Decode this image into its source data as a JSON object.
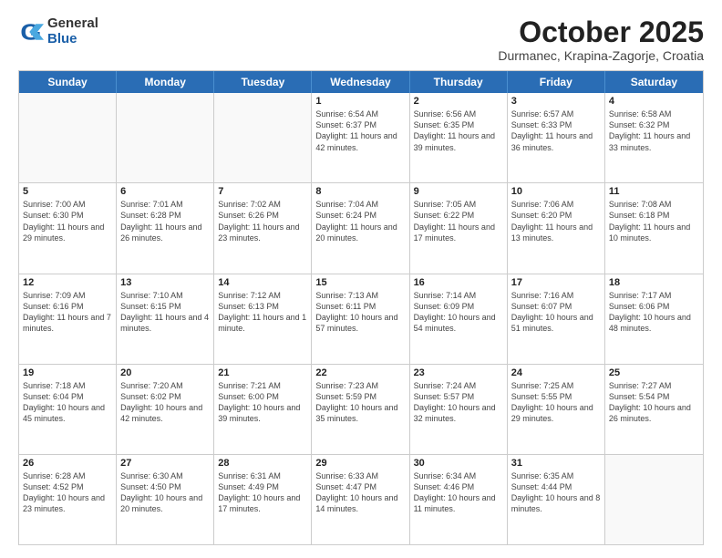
{
  "logo": {
    "general": "General",
    "blue": "Blue"
  },
  "title": "October 2025",
  "subtitle": "Durmanec, Krapina-Zagorje, Croatia",
  "headers": [
    "Sunday",
    "Monday",
    "Tuesday",
    "Wednesday",
    "Thursday",
    "Friday",
    "Saturday"
  ],
  "weeks": [
    [
      {
        "day": "",
        "info": ""
      },
      {
        "day": "",
        "info": ""
      },
      {
        "day": "",
        "info": ""
      },
      {
        "day": "1",
        "info": "Sunrise: 6:54 AM\nSunset: 6:37 PM\nDaylight: 11 hours and 42 minutes."
      },
      {
        "day": "2",
        "info": "Sunrise: 6:56 AM\nSunset: 6:35 PM\nDaylight: 11 hours and 39 minutes."
      },
      {
        "day": "3",
        "info": "Sunrise: 6:57 AM\nSunset: 6:33 PM\nDaylight: 11 hours and 36 minutes."
      },
      {
        "day": "4",
        "info": "Sunrise: 6:58 AM\nSunset: 6:32 PM\nDaylight: 11 hours and 33 minutes."
      }
    ],
    [
      {
        "day": "5",
        "info": "Sunrise: 7:00 AM\nSunset: 6:30 PM\nDaylight: 11 hours and 29 minutes."
      },
      {
        "day": "6",
        "info": "Sunrise: 7:01 AM\nSunset: 6:28 PM\nDaylight: 11 hours and 26 minutes."
      },
      {
        "day": "7",
        "info": "Sunrise: 7:02 AM\nSunset: 6:26 PM\nDaylight: 11 hours and 23 minutes."
      },
      {
        "day": "8",
        "info": "Sunrise: 7:04 AM\nSunset: 6:24 PM\nDaylight: 11 hours and 20 minutes."
      },
      {
        "day": "9",
        "info": "Sunrise: 7:05 AM\nSunset: 6:22 PM\nDaylight: 11 hours and 17 minutes."
      },
      {
        "day": "10",
        "info": "Sunrise: 7:06 AM\nSunset: 6:20 PM\nDaylight: 11 hours and 13 minutes."
      },
      {
        "day": "11",
        "info": "Sunrise: 7:08 AM\nSunset: 6:18 PM\nDaylight: 11 hours and 10 minutes."
      }
    ],
    [
      {
        "day": "12",
        "info": "Sunrise: 7:09 AM\nSunset: 6:16 PM\nDaylight: 11 hours and 7 minutes."
      },
      {
        "day": "13",
        "info": "Sunrise: 7:10 AM\nSunset: 6:15 PM\nDaylight: 11 hours and 4 minutes."
      },
      {
        "day": "14",
        "info": "Sunrise: 7:12 AM\nSunset: 6:13 PM\nDaylight: 11 hours and 1 minute."
      },
      {
        "day": "15",
        "info": "Sunrise: 7:13 AM\nSunset: 6:11 PM\nDaylight: 10 hours and 57 minutes."
      },
      {
        "day": "16",
        "info": "Sunrise: 7:14 AM\nSunset: 6:09 PM\nDaylight: 10 hours and 54 minutes."
      },
      {
        "day": "17",
        "info": "Sunrise: 7:16 AM\nSunset: 6:07 PM\nDaylight: 10 hours and 51 minutes."
      },
      {
        "day": "18",
        "info": "Sunrise: 7:17 AM\nSunset: 6:06 PM\nDaylight: 10 hours and 48 minutes."
      }
    ],
    [
      {
        "day": "19",
        "info": "Sunrise: 7:18 AM\nSunset: 6:04 PM\nDaylight: 10 hours and 45 minutes."
      },
      {
        "day": "20",
        "info": "Sunrise: 7:20 AM\nSunset: 6:02 PM\nDaylight: 10 hours and 42 minutes."
      },
      {
        "day": "21",
        "info": "Sunrise: 7:21 AM\nSunset: 6:00 PM\nDaylight: 10 hours and 39 minutes."
      },
      {
        "day": "22",
        "info": "Sunrise: 7:23 AM\nSunset: 5:59 PM\nDaylight: 10 hours and 35 minutes."
      },
      {
        "day": "23",
        "info": "Sunrise: 7:24 AM\nSunset: 5:57 PM\nDaylight: 10 hours and 32 minutes."
      },
      {
        "day": "24",
        "info": "Sunrise: 7:25 AM\nSunset: 5:55 PM\nDaylight: 10 hours and 29 minutes."
      },
      {
        "day": "25",
        "info": "Sunrise: 7:27 AM\nSunset: 5:54 PM\nDaylight: 10 hours and 26 minutes."
      }
    ],
    [
      {
        "day": "26",
        "info": "Sunrise: 6:28 AM\nSunset: 4:52 PM\nDaylight: 10 hours and 23 minutes."
      },
      {
        "day": "27",
        "info": "Sunrise: 6:30 AM\nSunset: 4:50 PM\nDaylight: 10 hours and 20 minutes."
      },
      {
        "day": "28",
        "info": "Sunrise: 6:31 AM\nSunset: 4:49 PM\nDaylight: 10 hours and 17 minutes."
      },
      {
        "day": "29",
        "info": "Sunrise: 6:33 AM\nSunset: 4:47 PM\nDaylight: 10 hours and 14 minutes."
      },
      {
        "day": "30",
        "info": "Sunrise: 6:34 AM\nSunset: 4:46 PM\nDaylight: 10 hours and 11 minutes."
      },
      {
        "day": "31",
        "info": "Sunrise: 6:35 AM\nSunset: 4:44 PM\nDaylight: 10 hours and 8 minutes."
      },
      {
        "day": "",
        "info": ""
      }
    ]
  ]
}
